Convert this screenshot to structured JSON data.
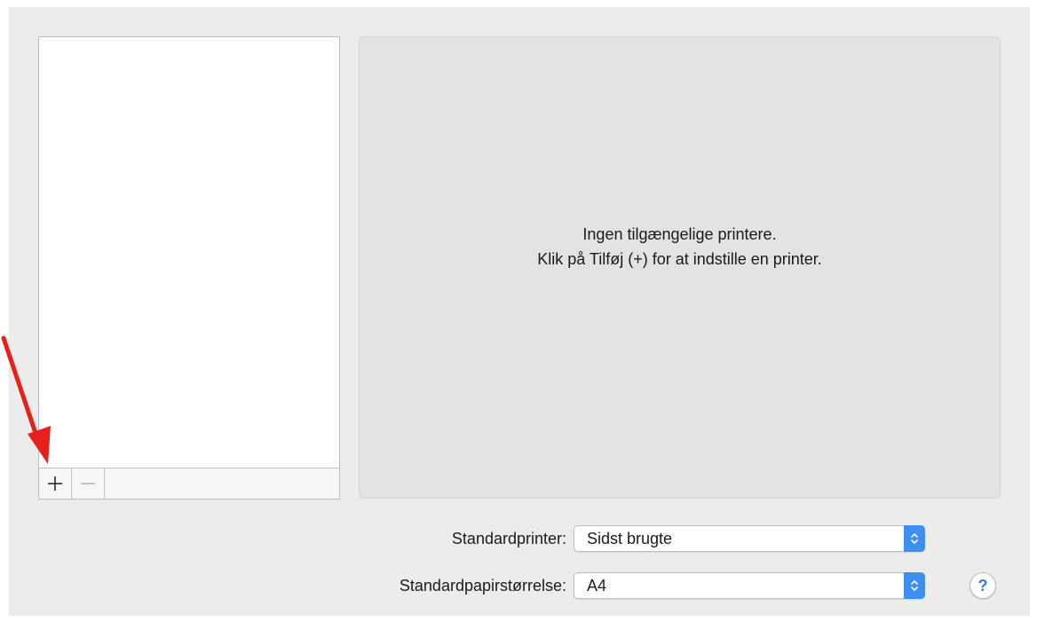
{
  "printer_list": {
    "add_icon": "plus-icon",
    "remove_icon": "minus-icon"
  },
  "detail_panel": {
    "message_line1": "Ingen tilgængelige printere.",
    "message_line2": "Klik på Tilføj (+) for at indstille en printer."
  },
  "default_printer": {
    "label": "Standardprinter:",
    "value": "Sidst brugte"
  },
  "default_paper": {
    "label": "Standardpapirstørrelse:",
    "value": "A4"
  },
  "help": {
    "label": "?"
  },
  "colors": {
    "window_bg": "#ececec",
    "panel_bg": "#e3e3e3",
    "accent": "#3d8ff6",
    "annotation_arrow": "#e8201c"
  }
}
